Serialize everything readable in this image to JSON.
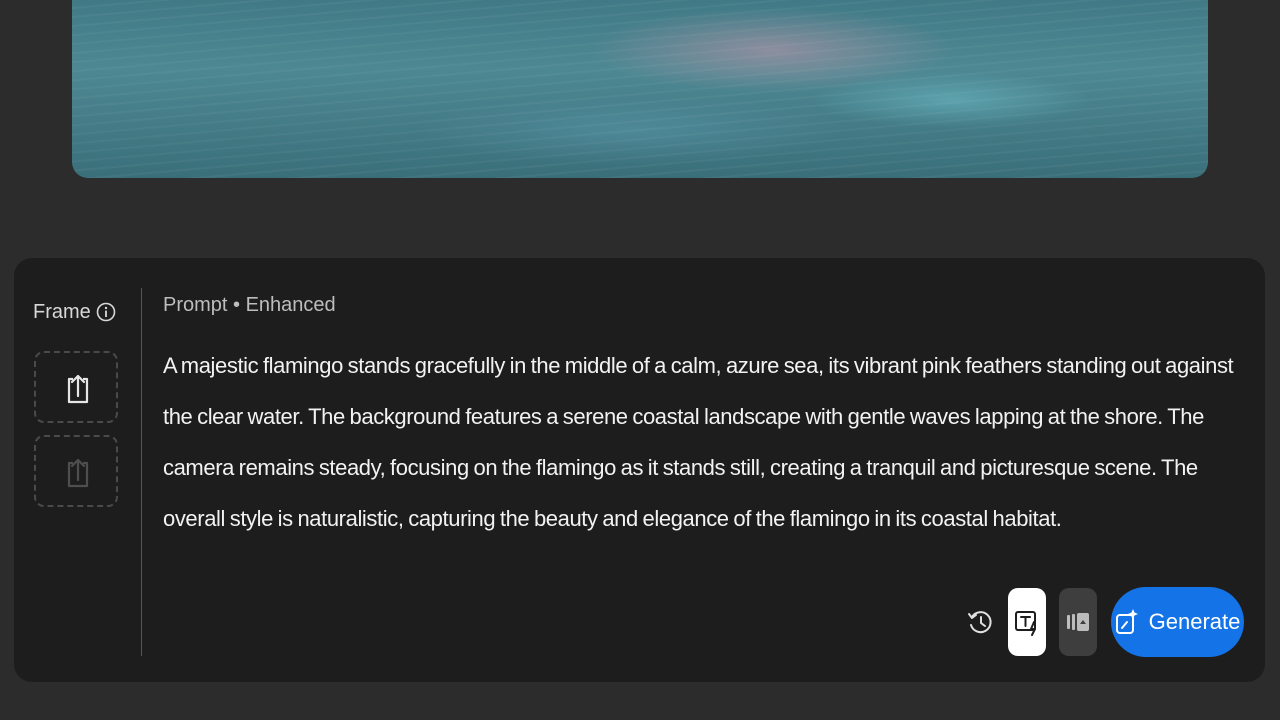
{
  "frame": {
    "label": "Frame"
  },
  "prompt": {
    "label": "Prompt • Enhanced",
    "text": "A majestic flamingo stands gracefully in the middle of a calm, azure sea, its vibrant pink feathers standing out against the clear water. The background features a serene coastal landscape with gentle waves lapping at the shore. The camera remains steady, focusing on the flamingo as it stands still, creating a tranquil and picturesque scene. The overall style is naturalistic, capturing the beauty and elegance of the flamingo in its coastal habitat."
  },
  "toolbar": {
    "generate_label": "Generate"
  },
  "icons": {
    "info": "info-icon",
    "upload": "upload-icon",
    "history": "history-icon",
    "text_style": "text-style-icon",
    "reference": "reference-image-icon",
    "generate": "generate-sparkle-icon"
  },
  "colors": {
    "accent": "#1473e6",
    "panel": "#1d1d1d",
    "background": "#2c2c2c"
  }
}
